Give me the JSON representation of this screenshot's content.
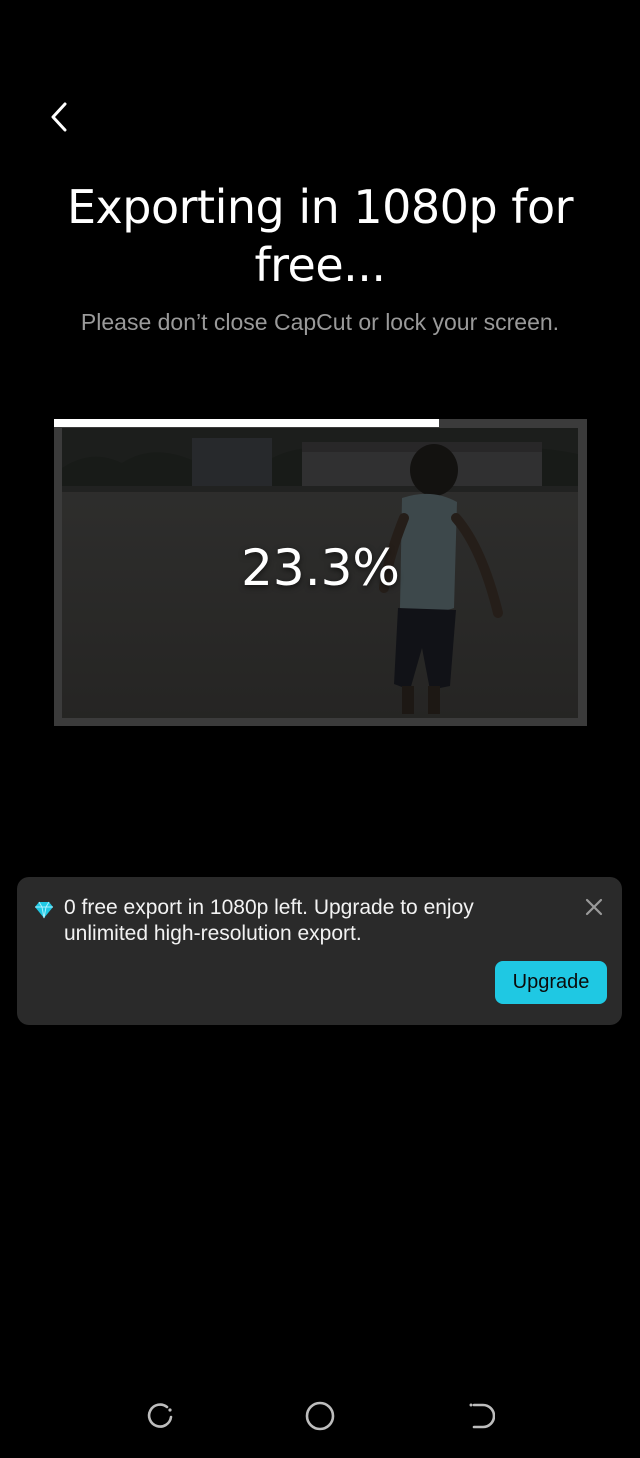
{
  "header": {
    "back_icon": "chevron-left-icon",
    "title": "Exporting in 1080p for free...",
    "subtitle": "Please don’t close CapCut or lock your screen."
  },
  "export": {
    "progress_text": "23.3%",
    "progress_bar_fraction": 0.723
  },
  "notice": {
    "icon": "diamond-icon",
    "message": "0 free export in 1080p left. Upgrade to enjoy unlimited high-resolution export.",
    "close_icon": "close-icon",
    "upgrade_label": "Upgrade"
  },
  "navigation": {
    "recents_icon": "recent-apps-icon",
    "home_icon": "home-icon",
    "back_icon": "back-icon"
  },
  "colors": {
    "background": "#000000",
    "accent": "#1fc8e3",
    "card": "#2a2a2a",
    "progress": "#ffffff"
  }
}
